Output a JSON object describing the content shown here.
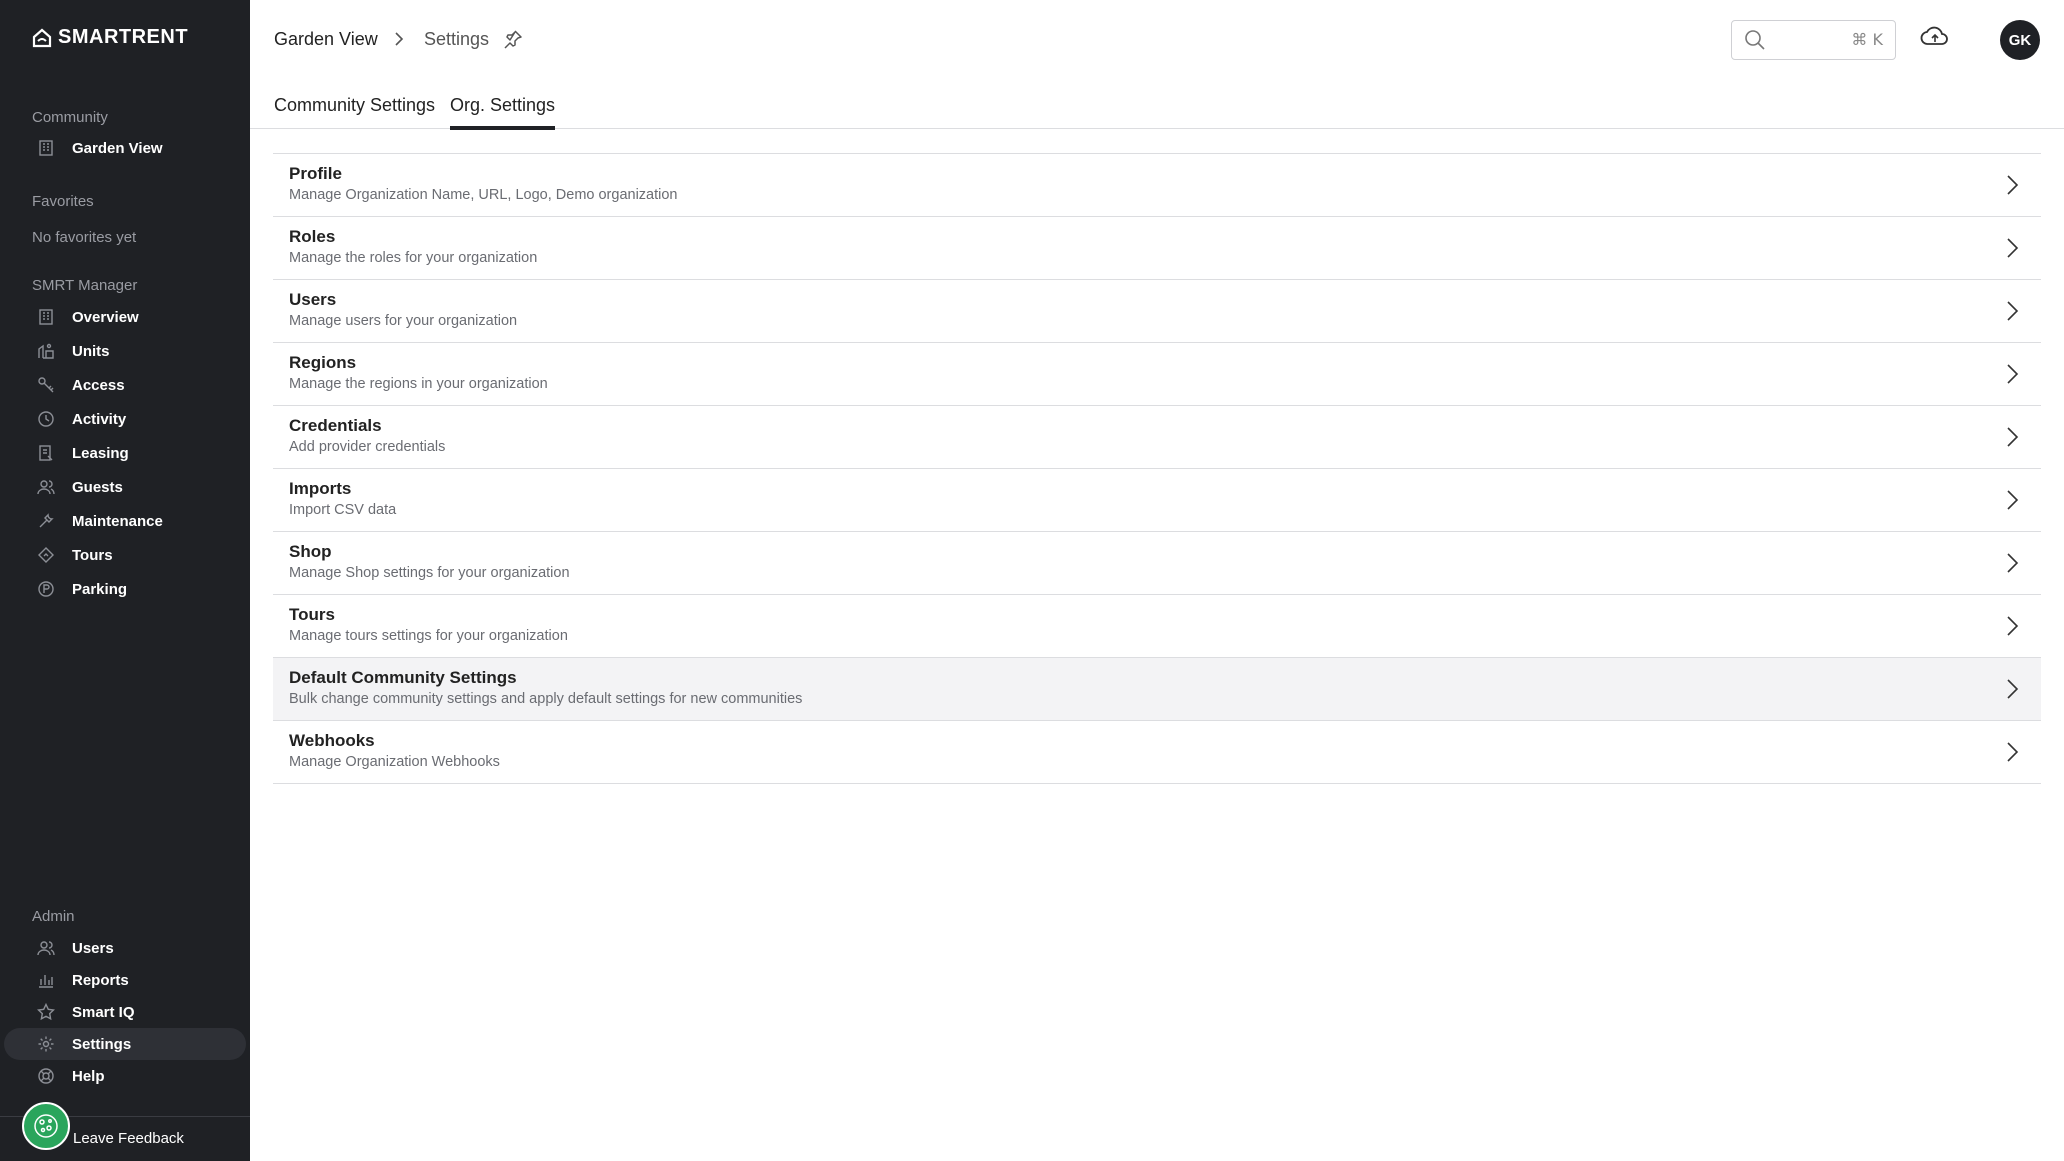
{
  "brand": {
    "name": "SMARTRENT"
  },
  "sidebar": {
    "community_label": "Community",
    "community_item": "Garden View",
    "favorites_label": "Favorites",
    "favorites_empty": "No favorites yet",
    "manager_label": "SMRT Manager",
    "manager_items": [
      {
        "label": "Overview",
        "icon": "building-icon"
      },
      {
        "label": "Units",
        "icon": "units-icon"
      },
      {
        "label": "Access",
        "icon": "key-icon"
      },
      {
        "label": "Activity",
        "icon": "clock-icon"
      },
      {
        "label": "Leasing",
        "icon": "leasing-icon"
      },
      {
        "label": "Guests",
        "icon": "guests-icon"
      },
      {
        "label": "Maintenance",
        "icon": "wrench-icon"
      },
      {
        "label": "Tours",
        "icon": "tours-icon"
      },
      {
        "label": "Parking",
        "icon": "parking-icon"
      }
    ],
    "admin_label": "Admin",
    "admin_items": [
      {
        "label": "Users",
        "icon": "users-icon"
      },
      {
        "label": "Reports",
        "icon": "reports-icon"
      },
      {
        "label": "Smart IQ",
        "icon": "star-icon"
      },
      {
        "label": "Settings",
        "icon": "gear-icon",
        "active": true
      },
      {
        "label": "Help",
        "icon": "help-icon"
      }
    ],
    "feedback_label": "Leave Feedback"
  },
  "header": {
    "breadcrumb": [
      "Garden View",
      "Settings"
    ],
    "search": {
      "value": "",
      "placeholder": "",
      "shortcut": "⌘ K"
    },
    "avatar_initials": "GK"
  },
  "tabs": [
    {
      "label": "Community Settings",
      "active": false
    },
    {
      "label": "Org. Settings",
      "active": true
    }
  ],
  "settings": [
    {
      "title": "Profile",
      "subtitle": "Manage Organization Name, URL, Logo, Demo organization"
    },
    {
      "title": "Roles",
      "subtitle": "Manage the roles for your organization"
    },
    {
      "title": "Users",
      "subtitle": "Manage users for your organization"
    },
    {
      "title": "Regions",
      "subtitle": "Manage the regions in your organization"
    },
    {
      "title": "Credentials",
      "subtitle": "Add provider credentials"
    },
    {
      "title": "Imports",
      "subtitle": "Import CSV data"
    },
    {
      "title": "Shop",
      "subtitle": "Manage Shop settings for your organization"
    },
    {
      "title": "Tours",
      "subtitle": "Manage tours settings for your organization"
    },
    {
      "title": "Default Community Settings",
      "subtitle": "Bulk change community settings and apply default settings for new communities",
      "highlighted": true
    },
    {
      "title": "Webhooks",
      "subtitle": "Manage Organization Webhooks"
    }
  ],
  "colors": {
    "sidebar_bg": "#1f2125",
    "accent": "#1f2125",
    "feedback": "#2aa55c"
  }
}
